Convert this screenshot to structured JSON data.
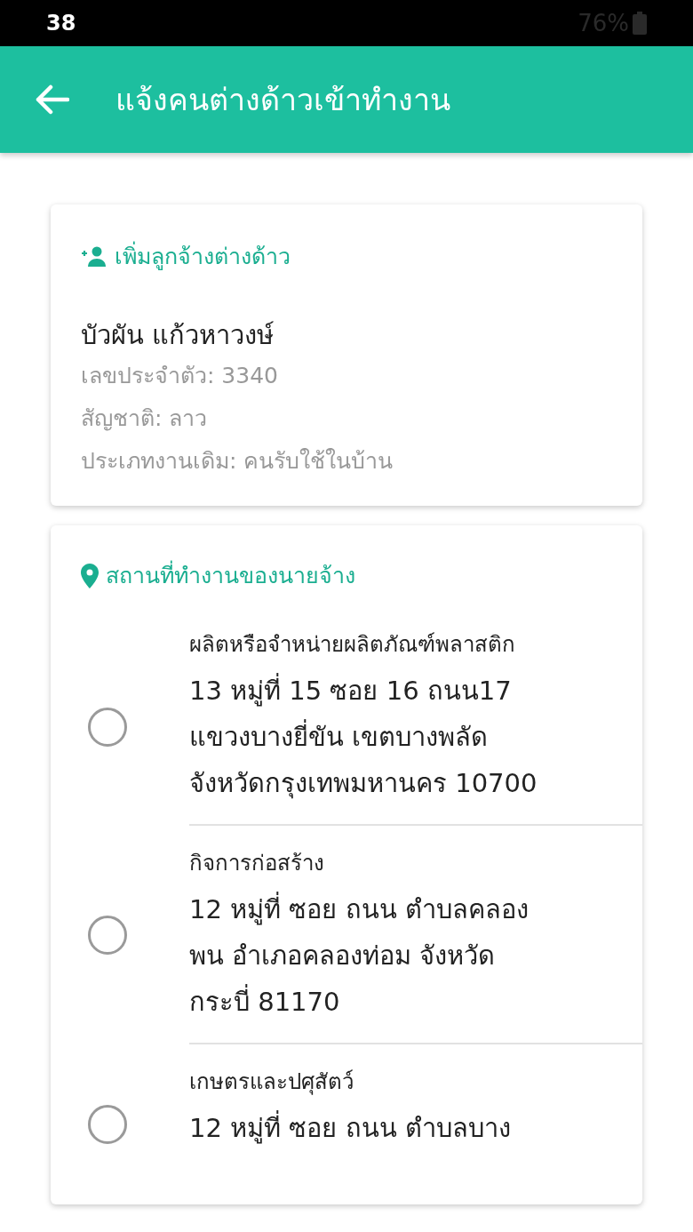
{
  "status_bar": {
    "time": "38",
    "battery": "76%"
  },
  "app_bar": {
    "title": "แจ้งคนต่างด้าวเข้าทำงาน"
  },
  "employee_card": {
    "heading": "เพิ่มลูกจ้างต่างด้าว",
    "name": "บัวผัน แก้วหาวงษ์",
    "details": [
      "เลขประจำตัว: 3340",
      "สัญชาติ: ลาว",
      "ประเภทงานเดิม: คนรับใช้ในบ้าน"
    ]
  },
  "workplace_card": {
    "heading": "สถานที่ทำงานของนายจ้าง",
    "options": [
      {
        "category": "ผลิตหรือจำหน่ายผลิตภัณฑ์พลาสติก",
        "address_lines": [
          "13 หมู่ที่ 15 ซอย 16 ถนน17",
          "แขวงบางยี่ขัน เขตบางพลัด",
          "จังหวัดกรุงเทพมหานคร 10700"
        ],
        "selected": false
      },
      {
        "category": "กิจการก่อสร้าง",
        "address_lines": [
          "12 หมู่ที่ ซอย ถนน ตำบลคลอง",
          "พน อำเภอคลองท่อม จังหวัด",
          "กระบี่ 81170"
        ],
        "selected": false
      },
      {
        "category": "เกษตรและปศุสัตว์",
        "address_lines": [
          "12 หมู่ที่ ซอย ถนน ตำบลบาง"
        ],
        "selected": false
      }
    ]
  }
}
